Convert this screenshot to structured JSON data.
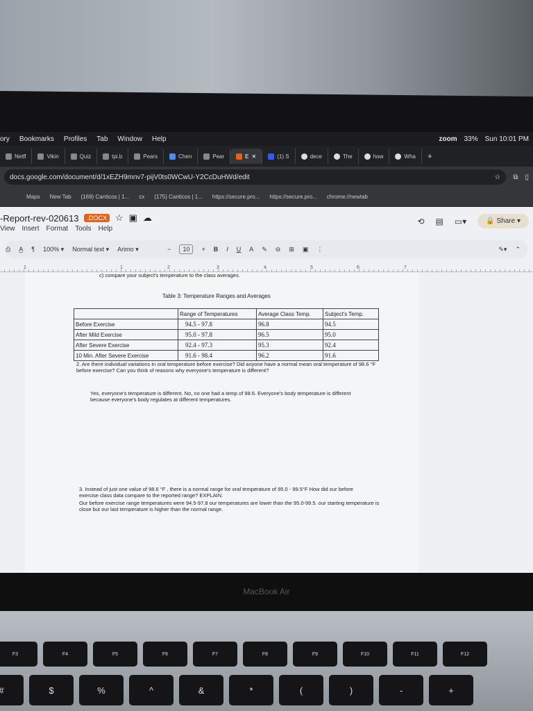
{
  "menubar": {
    "items": [
      "ory",
      "Bookmarks",
      "Profiles",
      "Tab",
      "Window",
      "Help"
    ],
    "zoom": "zoom",
    "battery": "33%",
    "clock": "Sun 10:01 PM"
  },
  "tabs": [
    "Netfl",
    "Vikin",
    "Quiz",
    "tpi.b",
    "Pears",
    "Chen",
    "Pear",
    "E",
    "(1) S",
    "dece",
    "The",
    "how",
    "Wha"
  ],
  "url": "docs.google.com/document/d/1xEZH9mnv7-pijV0ts0WCwU-Y2CcDuHWd/edit",
  "bookmarks": [
    "Maps",
    "New Tab",
    "(169) Canticos | 1...",
    "cx",
    "(175) Canticos | 1...",
    "https://secure.pro...",
    "https://secure.pro...",
    "chrome://newtab"
  ],
  "doc": {
    "title": "-Report-rev-020613",
    "badge": ".DOCX",
    "menus": [
      "View",
      "Insert",
      "Format",
      "Tools",
      "Help"
    ],
    "share": "Share"
  },
  "toolbar": {
    "zoom": "100%",
    "style": "Normal text",
    "font": "Arimo",
    "size": "10"
  },
  "ruler": [
    "1",
    "1",
    "2",
    "3",
    "4",
    "5",
    "6",
    "7"
  ],
  "content": {
    "intro": "c) compare your subject's temperature to the class averages.",
    "caption": "Table 3:  Temperature Ranges and Averages",
    "headers": [
      "",
      "Range of Temperatures",
      "Average Class Temp.",
      "Subject's Temp."
    ],
    "rows": [
      [
        "Before Exercise",
        "94.5 - 97.8",
        "96.8",
        "94.5"
      ],
      [
        "After Mild Exercise",
        "95.0 - 97.8",
        "96.5",
        "95.0"
      ],
      [
        "After Severe Exercise",
        "92.4 - 97.3",
        "95.3",
        "92.4"
      ],
      [
        "10 Min. After Severe Exercise",
        "91.6 - 98.4",
        "96.2",
        "91.6"
      ]
    ],
    "q2": "2.   Are there individual variations in oral temperature before exercise?  Did anyone have a normal mean oral temperature of 98.6 °F before exercise? Can you think of reasons why everyone's temperature is different?",
    "a2": "Yes, everyone's temperature is different. No, no one had a temp of 98.6. Everyone's body temperature is different because everyone's body regulates at different temperatures.",
    "q3": "3.   Instead of just one value of 98.6 °F , there is a normal range for oral temperature of 95.0 - 99.5°F  How did our before exercise class data compare to the reported range? EXPLAIN.",
    "a3": "Our before exercise range temperatures were 94.5-97.8 our temperatures are lower than the 95.0-99.5. our starting temperature is close but our last temperature is higher than the normal range."
  },
  "laptop": "MacBook Air",
  "keys": [
    [
      "F3",
      "F4",
      "F5",
      "F6",
      "F7",
      "F8",
      "F9",
      "F10",
      "F11",
      "F12"
    ],
    [
      "#",
      "$",
      "%",
      "^",
      "&",
      "*",
      "(",
      ")",
      "-",
      "+"
    ]
  ]
}
